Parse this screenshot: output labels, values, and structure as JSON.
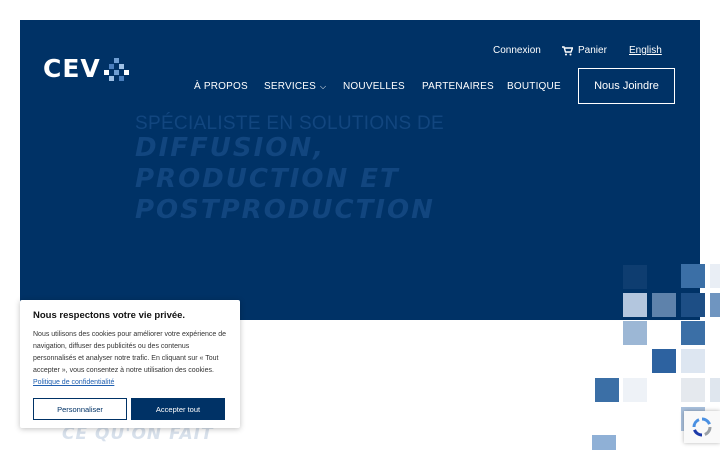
{
  "brand": {
    "logo_text": "CEV"
  },
  "top_links": {
    "login": "Connexion",
    "cart": "Panier",
    "language": "English"
  },
  "nav": {
    "items": [
      {
        "label": "À PROPOS"
      },
      {
        "label": "SERVICES"
      },
      {
        "label": "NOUVELLES"
      },
      {
        "label": "PARTENAIRES"
      },
      {
        "label": "BOUTIQUE"
      }
    ],
    "cta": "Nous Joindre"
  },
  "hero": {
    "subtitle": "SPÉCIALISTE EN SOLUTIONS DE",
    "title_lines": [
      "DIFFUSION,",
      "PRODUCTION ET",
      "POSTPRODUCTION"
    ]
  },
  "section": {
    "title": "CE QU'ON FAIT"
  },
  "cookie": {
    "title": "Nous respectons votre vie privée.",
    "body": "Nous utilisons des cookies pour améliorer votre expérience de navigation, diffuser des publicités ou des contenus personnalisés et analyser notre trafic. En cliquant sur « Tout accepter », vous consentez à notre utilisation des cookies.",
    "link": "Politique de confidentialité",
    "customize": "Personnaliser",
    "accept": "Accepter tout"
  },
  "colors": {
    "brand_navy": "#003266",
    "hero_text_faded": "#12467f",
    "accent_blue": "#3b6fa6"
  },
  "icons": {
    "cart": "cart-icon",
    "chevron": "chevron-down-icon",
    "recaptcha": "recaptcha-icon"
  }
}
